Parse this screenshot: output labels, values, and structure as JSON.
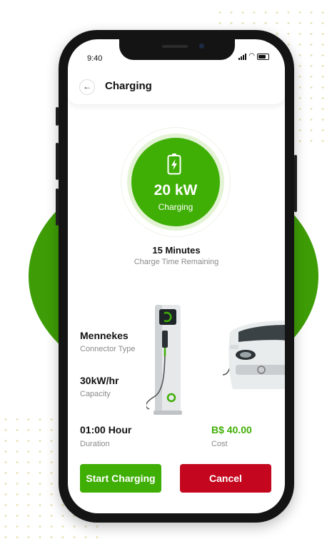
{
  "status_bar": {
    "time": "9:40",
    "icons": [
      "signal-icon",
      "wifi-icon",
      "battery-icon"
    ]
  },
  "header": {
    "title": "Charging",
    "back_icon": "arrow-left-icon"
  },
  "gauge": {
    "power": "20 kW",
    "state": "Charging",
    "icon": "battery-charging-icon"
  },
  "charge_time": {
    "value": "15 Minutes",
    "label": "Charge Time Remaining"
  },
  "specs": {
    "connector": {
      "value": "Mennekes",
      "label": "Connector Type"
    },
    "capacity": {
      "value": "30kW/hr",
      "label": "Capacity"
    },
    "duration": {
      "value": "01:00 Hour",
      "label": "Duration"
    },
    "cost": {
      "value": "B$  40.00",
      "label": "Cost"
    }
  },
  "actions": {
    "start_label": "Start Charging",
    "cancel_label": "Cancel"
  },
  "colors": {
    "primary_green": "#3faf06",
    "light_green": "#e4f3d6",
    "cancel_red": "#c4071e",
    "background_circle": "#3e9d06"
  }
}
